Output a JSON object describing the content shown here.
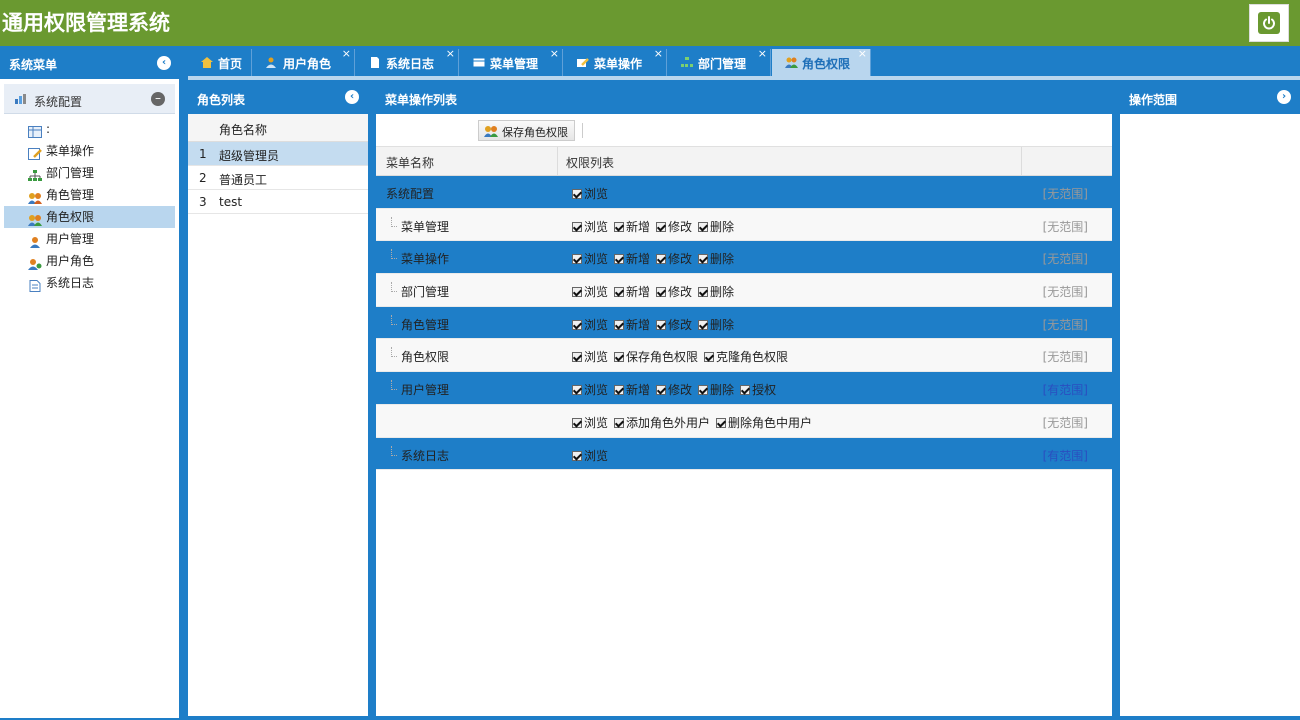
{
  "app": {
    "title": "通用权限管理系统"
  },
  "sidebar": {
    "title": "系统菜单",
    "group": "系统配置",
    "items": [
      {
        "label": ":"
      },
      {
        "label": "菜单操作"
      },
      {
        "label": "部门管理"
      },
      {
        "label": "角色管理"
      },
      {
        "label": "角色权限"
      },
      {
        "label": "用户管理"
      },
      {
        "label": "用户角色"
      },
      {
        "label": "系统日志"
      }
    ]
  },
  "tabs": [
    {
      "label": "首页"
    },
    {
      "label": "用户角色"
    },
    {
      "label": "系统日志"
    },
    {
      "label": "菜单管理"
    },
    {
      "label": "菜单操作"
    },
    {
      "label": "部门管理"
    },
    {
      "label": "角色权限"
    }
  ],
  "role_panel": {
    "title": "角色列表",
    "column": "角色名称",
    "rows": [
      {
        "num": "1",
        "name": "超级管理员"
      },
      {
        "num": "2",
        "name": "普通员工"
      },
      {
        "num": "3",
        "name": "test"
      }
    ]
  },
  "menu_panel": {
    "title": "菜单操作列表",
    "save_label": "保存角色权限",
    "col_name": "菜单名称",
    "col_perms": "权限列表",
    "rows": [
      {
        "name": "系统配置",
        "perms": [
          "浏览"
        ],
        "scope": "[无范围]"
      },
      {
        "name": "菜单管理",
        "perms": [
          "浏览",
          "新增",
          "修改",
          "删除"
        ],
        "scope": "[无范围]"
      },
      {
        "name": "菜单操作",
        "perms": [
          "浏览",
          "新增",
          "修改",
          "删除"
        ],
        "scope": "[无范围]"
      },
      {
        "name": "部门管理",
        "perms": [
          "浏览",
          "新增",
          "修改",
          "删除"
        ],
        "scope": "[无范围]"
      },
      {
        "name": "角色管理",
        "perms": [
          "浏览",
          "新增",
          "修改",
          "删除"
        ],
        "scope": "[无范围]"
      },
      {
        "name": "角色权限",
        "perms": [
          "浏览",
          "保存角色权限",
          "克隆角色权限"
        ],
        "scope": "[无范围]"
      },
      {
        "name": "用户管理",
        "perms": [
          "浏览",
          "新增",
          "修改",
          "删除",
          "授权"
        ],
        "scope": "[有范围]"
      },
      {
        "name": "",
        "perms": [
          "浏览",
          "添加角色外用户",
          "删除角色中用户"
        ],
        "scope": "[无范围]"
      },
      {
        "name": "系统日志",
        "perms": [
          "浏览"
        ],
        "scope": "[有范围]"
      }
    ]
  },
  "scope_panel": {
    "title": "操作范围"
  },
  "colors": {
    "green": "#6a9930",
    "blue": "#1e7ec8",
    "selected": "#b9d6ee",
    "link": "#2a4fc0"
  }
}
